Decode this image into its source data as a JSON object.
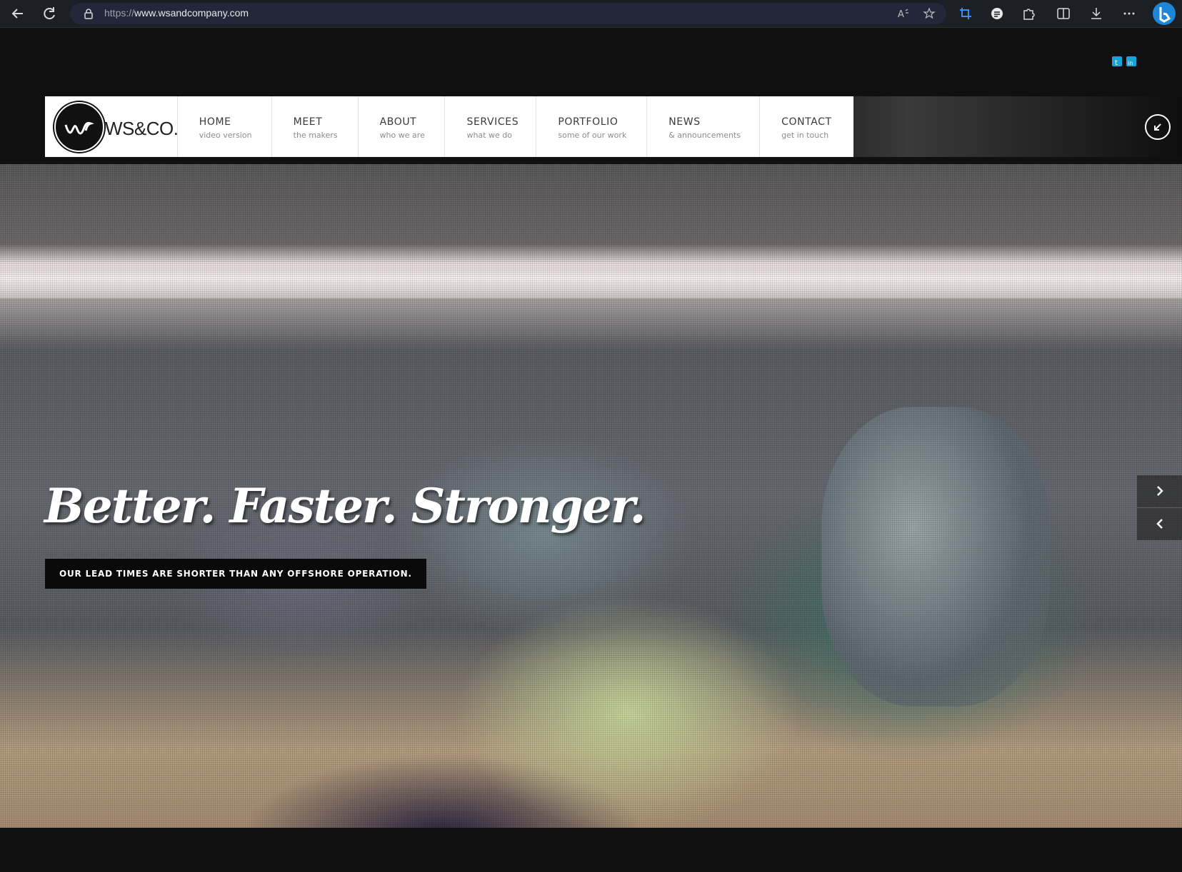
{
  "browser": {
    "url_protocol": "https://",
    "url_host": "www.wsandcompany.com"
  },
  "header": {
    "logo_text": "WS&CO.",
    "menu": [
      {
        "label": "HOME",
        "sub": "video version"
      },
      {
        "label": "MEET",
        "sub": "the makers"
      },
      {
        "label": "ABOUT",
        "sub": "who we are"
      },
      {
        "label": "SERVICES",
        "sub": "what we do"
      },
      {
        "label": "PORTFOLIO",
        "sub": "some of our work"
      },
      {
        "label": "NEWS",
        "sub": "& announcements"
      },
      {
        "label": "CONTACT",
        "sub": "get in touch"
      }
    ]
  },
  "social": {
    "icons": [
      "twitter-icon",
      "linkedin-icon"
    ],
    "twitter_glyph": "t",
    "linkedin_glyph": "in",
    "accent": "#1aa3d6"
  },
  "hero": {
    "headline": "Better. Faster. Stronger.",
    "tagline": "OUR LEAD TIMES ARE SHORTER THAN ANY OFFSHORE OPERATION."
  }
}
